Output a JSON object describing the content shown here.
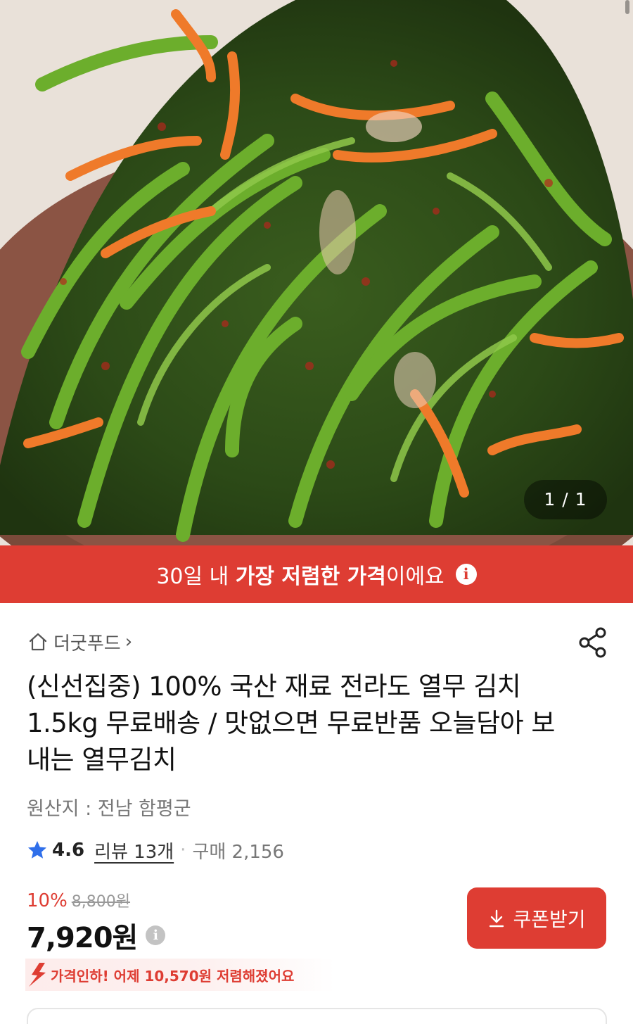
{
  "product_image": {
    "page_counter": "1 / 1"
  },
  "banner": {
    "text_before": "30일 내 ",
    "text_bold": "가장 저렴한 가격",
    "text_after": "이에요",
    "info_icon": "i"
  },
  "store": {
    "name": "더굿푸드",
    "icon": "home-icon",
    "chevron": "›"
  },
  "share": {
    "icon": "share-icon"
  },
  "title": "(신선집중) 100% 국산 재료 전라도 열무 김치 1.5kg 무료배송 / 맛없으면 무료반품 오늘담아 보내는 열무김치",
  "origin": "원산지 : 전남 함평군",
  "rating": {
    "score": "4.6",
    "review_label": "리뷰 13개",
    "separator": "·",
    "purchase_label": "구매 2,156",
    "star_color": "#2f6fea"
  },
  "pricing": {
    "discount_percent": "10%",
    "original_price": "8,800원",
    "final_price": "7,920원",
    "info_icon": "i",
    "price_drop_text": "가격인하! 어제 10,570원 저렴해졌어요"
  },
  "coupon_button": {
    "label": "쿠폰받기",
    "icon": "download-icon"
  },
  "colors": {
    "accent": "#de3d33",
    "muted": "#777777"
  }
}
